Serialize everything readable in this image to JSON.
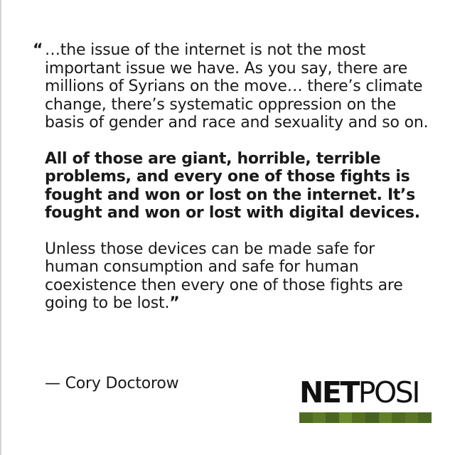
{
  "quote": {
    "open_mark": "“",
    "paragraph_1": "…the issue of the internet is not the most important issue we have. As you say, there are millions of Syrians on the move… there’s climate change, there’s systematic oppression on the basis of gender and race and sexuality and so on.",
    "paragraph_2": "All of those are giant, horrible, terrible problems, and every one of those fights is fought and won or lost on the internet. It’s fought and won or lost with digital devices.",
    "paragraph_3": "Unless those devices can be made safe for human consumption and safe for human coexistence then every one of those fights are going to be lost.",
    "close_mark": "”"
  },
  "attribution": "— Cory Doctorow",
  "logo": {
    "part_bold": "NET",
    "part_light": "POSI",
    "bar_colors": [
      "#4f6b21",
      "#5d7a28",
      "#4a651f",
      "#6a8a2f",
      "#54701f",
      "#476121",
      "#62802a",
      "#4f6b21",
      "#5a7626",
      "#4c6720"
    ]
  }
}
